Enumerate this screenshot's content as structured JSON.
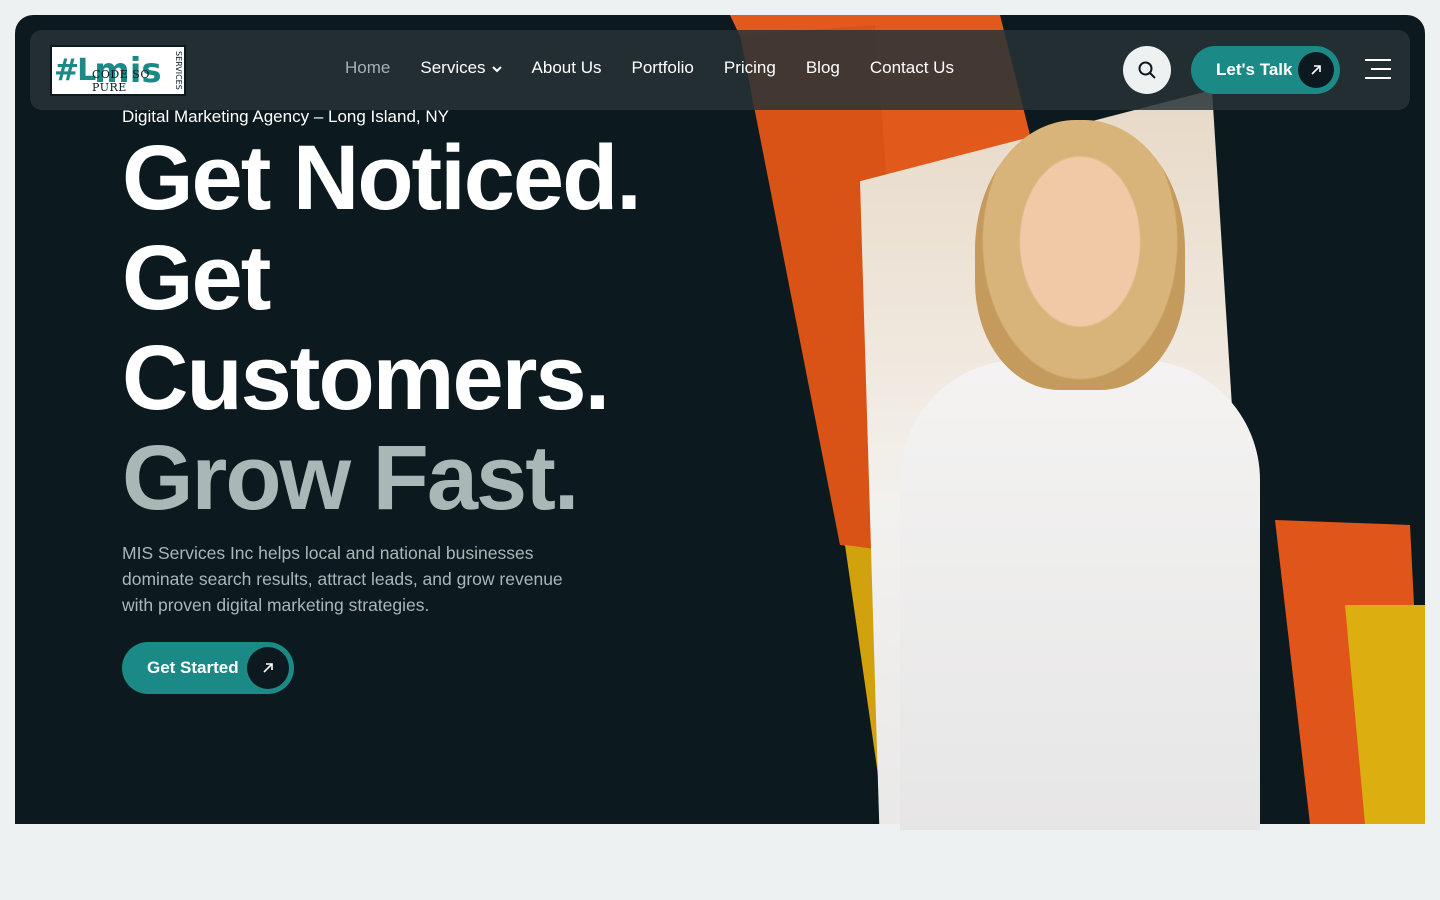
{
  "brand": {
    "logo_mark": "#L",
    "logo_text": "mis",
    "logo_sub": "CODE SO PURE",
    "logo_side": "SERVICES"
  },
  "nav": {
    "items": [
      {
        "label": "Home",
        "active": true
      },
      {
        "label": "Services",
        "has_dropdown": true
      },
      {
        "label": "About Us"
      },
      {
        "label": "Portfolio"
      },
      {
        "label": "Pricing"
      },
      {
        "label": "Blog"
      },
      {
        "label": "Contact Us"
      }
    ],
    "cta_label": "Let's Talk"
  },
  "hero": {
    "eyebrow": "Digital Marketing Agency – Long Island, NY",
    "headline": {
      "line1": "Get Noticed.",
      "line2": "Get",
      "line3": "Customers.",
      "line4": "Grow Fast."
    },
    "description": "MIS Services Inc helps local and national businesses dominate search results, attract leads, and grow revenue with proven digital marketing strategies.",
    "cta_label": "Get Started"
  },
  "icons": {
    "search": "search-icon",
    "arrow": "arrow-up-right-icon",
    "menu": "hamburger-icon",
    "chevron": "chevron-down-icon"
  },
  "colors": {
    "background": "#0c1a1f",
    "accent": "#1b8a86",
    "orange": "#e2591c",
    "yellow": "#d9ad0f",
    "muted_text": "#a9b7b6"
  }
}
